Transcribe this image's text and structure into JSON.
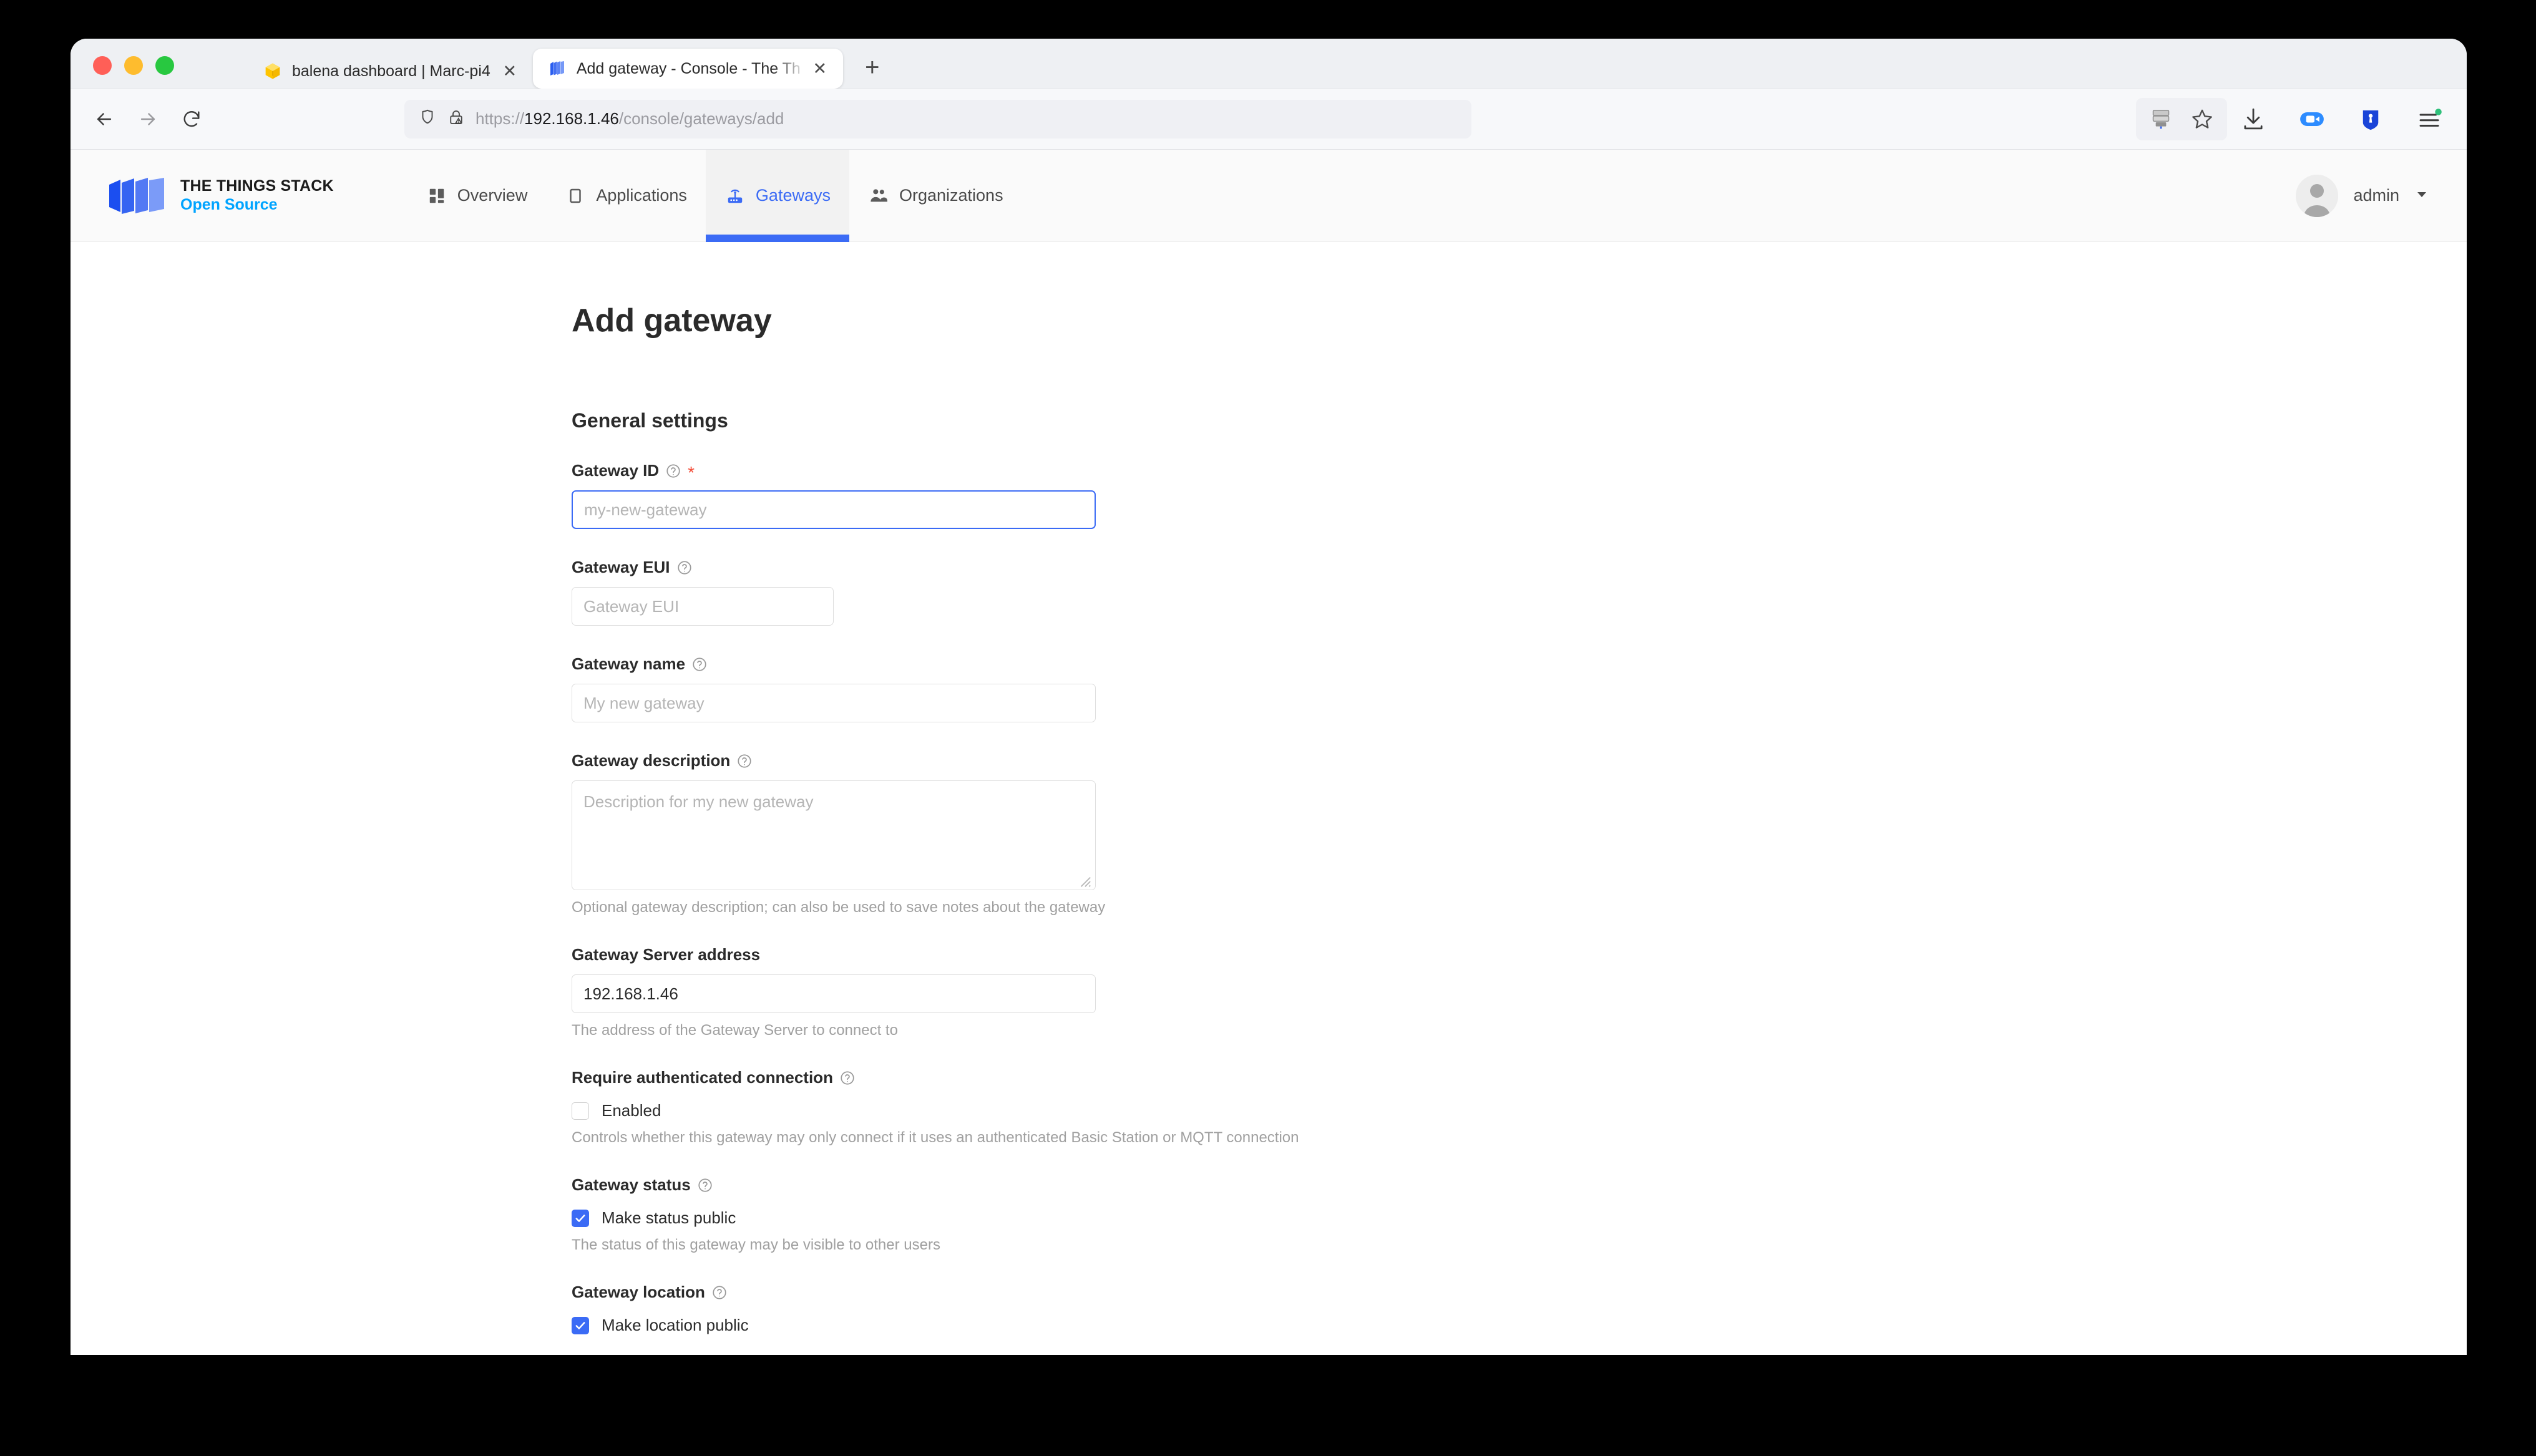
{
  "browser": {
    "traffic_lights": [
      "close",
      "minimize",
      "maximize"
    ],
    "tabs": [
      {
        "title": "balena dashboard | Marc-pi4",
        "favicon": "balena-cube-icon",
        "active": false
      },
      {
        "title": "Add gateway - Console - The Th",
        "favicon": "things-stack-icon",
        "active": true
      }
    ],
    "new_tab_label": "+",
    "close_glyph": "✕",
    "nav": {
      "back_label": "Back",
      "forward_label": "Forward",
      "reload_label": "Reload"
    },
    "url": {
      "scheme": "https://",
      "host": "192.168.1.46",
      "path": "/console/gateways/add",
      "full": "https://192.168.1.46/console/gateways/add",
      "shield_icon": "shield-icon",
      "lock_icon": "lock-warning-icon"
    },
    "omnibox_icons": [
      "server-icon",
      "bookmark-star-icon"
    ],
    "toolbar_icons": [
      "download-icon",
      "zoom-camera-icon",
      "password-shield-icon",
      "extensions-menu-icon"
    ]
  },
  "app": {
    "logo": {
      "mark": "things-stack-logo-icon",
      "title": "THE THINGS STACK",
      "subtitle": "Open Source",
      "subtitle_color": "#00a4ff"
    },
    "nav_items": [
      {
        "label": "Overview",
        "icon": "grid-icon",
        "active": false
      },
      {
        "label": "Applications",
        "icon": "application-icon",
        "active": false
      },
      {
        "label": "Gateways",
        "icon": "gateway-router-icon",
        "active": true
      },
      {
        "label": "Organizations",
        "icon": "users-icon",
        "active": false
      }
    ],
    "accent_color": "#3b6bf5",
    "user": {
      "name": "admin",
      "avatar": "user-avatar",
      "dropdown_glyph": "▾"
    }
  },
  "page": {
    "title": "Add gateway",
    "section_title": "General settings",
    "fields": [
      {
        "key": "gateway_id",
        "label": "Gateway ID",
        "has_help": true,
        "required": true,
        "placeholder": "my-new-gateway",
        "value": "",
        "focused": true,
        "width": "wide"
      },
      {
        "key": "gateway_eui",
        "label": "Gateway EUI",
        "has_help": true,
        "required": false,
        "placeholder": "Gateway EUI",
        "value": "",
        "focused": false,
        "width": "narrow"
      },
      {
        "key": "gateway_name",
        "label": "Gateway name",
        "has_help": true,
        "required": false,
        "placeholder": "My new gateway",
        "value": "",
        "focused": false,
        "width": "wide"
      },
      {
        "key": "gateway_description",
        "label": "Gateway description",
        "has_help": true,
        "required": false,
        "placeholder": "Description for my new gateway",
        "value": "",
        "helper": "Optional gateway description; can also be used to save notes about the gateway",
        "type": "textarea"
      },
      {
        "key": "gateway_server_address",
        "label": "Gateway Server address",
        "has_help": false,
        "required": false,
        "placeholder": "",
        "value": "192.168.1.46",
        "focused": false,
        "helper": "The address of the Gateway Server to connect to",
        "width": "wide"
      }
    ],
    "checkbox_groups": [
      {
        "key": "require_authenticated_connection",
        "label": "Require authenticated connection",
        "has_help": true,
        "checkbox_label": "Enabled",
        "checked": false,
        "helper": "Controls whether this gateway may only connect if it uses an authenticated Basic Station or MQTT connection"
      },
      {
        "key": "gateway_status",
        "label": "Gateway status",
        "has_help": true,
        "checkbox_label": "Make status public",
        "checked": true,
        "helper": "The status of this gateway may be visible to other users"
      },
      {
        "key": "gateway_location",
        "label": "Gateway location",
        "has_help": true,
        "checkbox_label": "Make location public",
        "checked": true,
        "helper": ""
      }
    ]
  }
}
